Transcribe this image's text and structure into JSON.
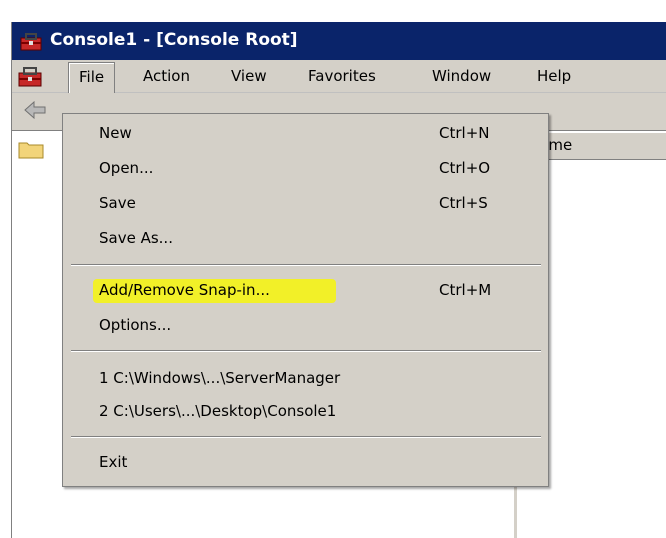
{
  "window": {
    "title": "Console1 - [Console Root]",
    "icon": "mmc-toolbox-icon"
  },
  "menubar": {
    "items": [
      {
        "label": "File"
      },
      {
        "label": "Action"
      },
      {
        "label": "View"
      },
      {
        "label": "Favorites"
      },
      {
        "label": "Window"
      },
      {
        "label": "Help"
      }
    ]
  },
  "list": {
    "header_partial": "lame"
  },
  "file_menu": {
    "items": [
      {
        "label": "New",
        "shortcut": "Ctrl+N"
      },
      {
        "label": "Open...",
        "shortcut": "Ctrl+O"
      },
      {
        "label": "Save",
        "shortcut": "Ctrl+S"
      },
      {
        "label": "Save As...",
        "shortcut": ""
      },
      {
        "label": "Add/Remove Snap-in...",
        "shortcut": "Ctrl+M",
        "highlighted": true
      },
      {
        "label": "Options...",
        "shortcut": ""
      },
      {
        "label": "1 C:\\Windows\\...\\ServerManager",
        "shortcut": ""
      },
      {
        "label": "2 C:\\Users\\...\\Desktop\\Console1",
        "shortcut": ""
      },
      {
        "label": "Exit",
        "shortcut": ""
      }
    ]
  },
  "colors": {
    "titlebar": "#0a246a",
    "highlight": "#f4f21a",
    "face": "#d4d0c8"
  }
}
